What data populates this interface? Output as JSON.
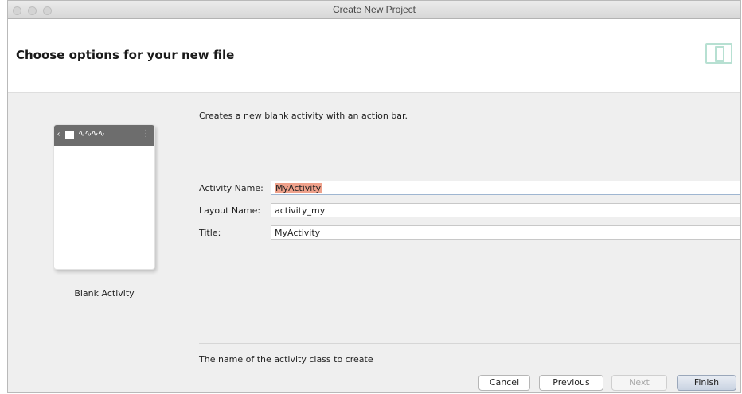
{
  "window": {
    "title": "Create New Project"
  },
  "header": {
    "title": "Choose options for your new file",
    "icon": "android-app-icon"
  },
  "template": {
    "label": "Blank Activity",
    "description": "Creates a new blank activity with an action bar."
  },
  "form": {
    "activity_name": {
      "label": "Activity Name:",
      "value": "MyActivity"
    },
    "layout_name": {
      "label": "Layout Name:",
      "value": "activity_my"
    },
    "title": {
      "label": "Title:",
      "value": "MyActivity"
    }
  },
  "hint": "The name of the activity class to create",
  "buttons": {
    "cancel": "Cancel",
    "previous": "Previous",
    "next": "Next",
    "finish": "Finish"
  },
  "colors": {
    "selection_highlight": "#efa18b",
    "icon_accent": "#b7e0d2"
  }
}
